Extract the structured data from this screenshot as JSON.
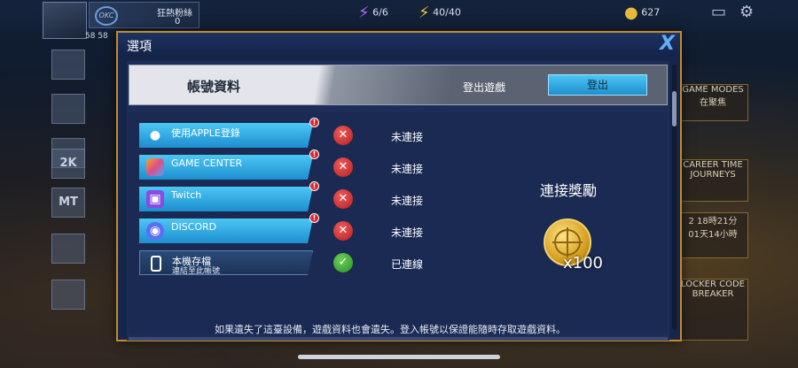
{
  "top_bar": {
    "player_level": "58 58",
    "team_name": "狂熱粉絲",
    "team_count": "0",
    "team_logo_text": "OKC",
    "energy": "6/6",
    "stamina": "40/40",
    "coins": "627"
  },
  "side_nav": {
    "items": [
      "",
      "",
      "",
      "2K",
      "MT",
      "",
      ""
    ]
  },
  "right_panel": {
    "items": [
      "GAME MODES",
      "在聚焦",
      "CAREER TIME JOURNEYS",
      "2 18時21分",
      "01天14小時",
      "LOCKER CODE BREAKER"
    ]
  },
  "modal": {
    "title": "選項",
    "close_label": "X",
    "account_section": {
      "title": "帳號資料",
      "logout_label": "登出遊戲",
      "logout_button": "登出"
    },
    "accounts": [
      {
        "icon": "apple-icon",
        "label": "使用APPLE登錄",
        "sub": "",
        "status": "未連接",
        "connected": false,
        "alert": "!"
      },
      {
        "icon": "game-center-icon",
        "label": "GAME CENTER",
        "sub": "",
        "status": "未連接",
        "connected": false,
        "alert": "!"
      },
      {
        "icon": "twitch-icon",
        "label": "Twitch",
        "sub": "",
        "status": "未連接",
        "connected": false,
        "alert": "!"
      },
      {
        "icon": "discord-icon",
        "label": "DISCORD",
        "sub": "",
        "status": "未連接",
        "connected": false,
        "alert": "!"
      },
      {
        "icon": "phone-icon",
        "label": "本機存檔",
        "sub": "連結至此帳號",
        "status": "已連線",
        "connected": true,
        "alert": ""
      }
    ],
    "reward": {
      "title": "連接獎勵",
      "amount": "x100"
    },
    "notice": "如果遺失了這臺設備，遊戲資料也會遺失。登入帳號以保證能隨時存取遊戲資料。"
  },
  "colors": {
    "accent_blue": "#1f8fcf",
    "modal_border": "#c7882d",
    "status_error": "#b31f22",
    "status_ok": "#2c8e22"
  }
}
